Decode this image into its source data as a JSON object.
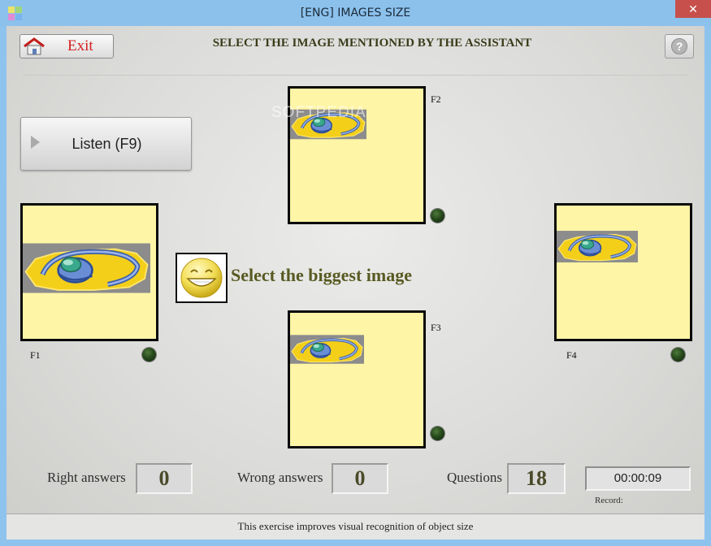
{
  "window": {
    "title": "[ENG] IMAGES SIZE",
    "close_glyph": "✕"
  },
  "header": {
    "exit_label": "Exit",
    "instruction": "SELECT THE IMAGE MENTIONED BY THE ASSISTANT",
    "help_glyph": "?"
  },
  "listen": {
    "label": "Listen  (F9)"
  },
  "task": {
    "text": "Select the biggest image"
  },
  "watermark": "SOFTPEDIA",
  "cards": [
    {
      "key": "F1",
      "image": "headphones-icon",
      "relative_size": "large"
    },
    {
      "key": "F2",
      "image": "headphones-icon",
      "relative_size": "small"
    },
    {
      "key": "F3",
      "image": "headphones-icon",
      "relative_size": "small"
    },
    {
      "key": "F4",
      "image": "headphones-icon",
      "relative_size": "medium"
    }
  ],
  "stats": {
    "right_label": "Right answers",
    "right_value": "0",
    "wrong_label": "Wrong answers",
    "wrong_value": "0",
    "questions_label": "Questions",
    "questions_value": "18",
    "timer": "00:00:09",
    "record_label": "Record:"
  },
  "footer": {
    "text": "This exercise improves visual recognition of object size"
  },
  "colors": {
    "title_bar": "#8cc1ec",
    "card_fill": "#fff5a6",
    "exit_red": "#d52020",
    "task_olive": "#585a22",
    "led_green": "#274a1c"
  }
}
